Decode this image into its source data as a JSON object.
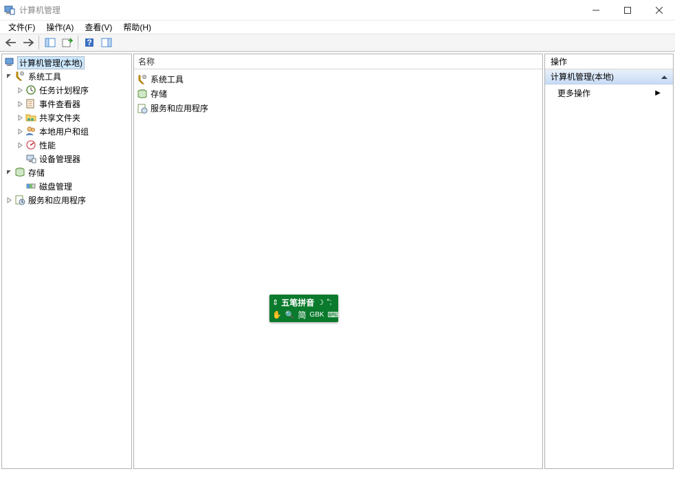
{
  "window": {
    "title": "计算机管理"
  },
  "menubar": {
    "file": "文件(F)",
    "action": "操作(A)",
    "view": "查看(V)",
    "help": "帮助(H)"
  },
  "tree": {
    "root": "计算机管理(本地)",
    "system_tools": "系统工具",
    "task_scheduler": "任务计划程序",
    "event_viewer": "事件查看器",
    "shared_folders": "共享文件夹",
    "local_users": "本地用户和组",
    "performance": "性能",
    "device_manager": "设备管理器",
    "storage": "存储",
    "disk_management": "磁盘管理",
    "services_apps": "服务和应用程序"
  },
  "list": {
    "header": "名称",
    "items": {
      "0": "系统工具",
      "1": "存储",
      "2": "服务和应用程序"
    }
  },
  "actions": {
    "header": "操作",
    "section": "计算机管理(本地)",
    "more": "更多操作"
  },
  "ime": {
    "name": "五笔拼音",
    "mode": "简",
    "charset": "GBK"
  }
}
